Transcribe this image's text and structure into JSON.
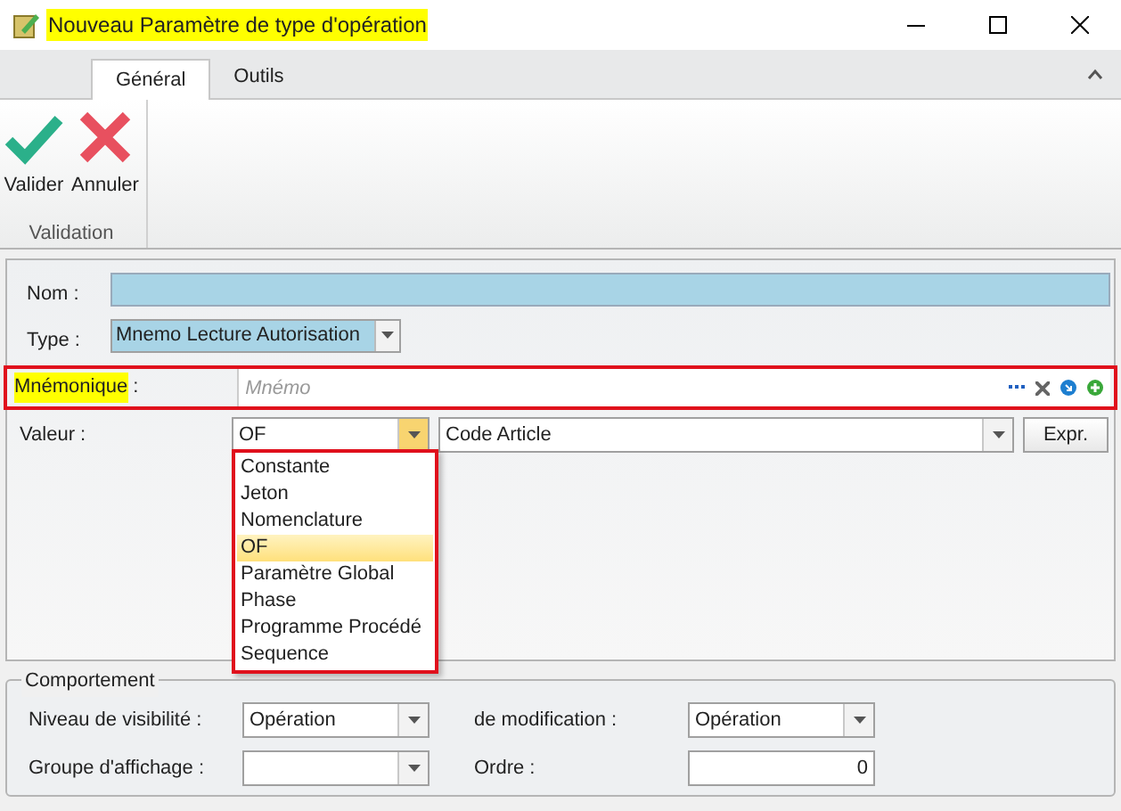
{
  "window": {
    "title": "Nouveau Paramètre de type d'opération",
    "title_highlighted": true
  },
  "ribbon": {
    "tabs": [
      {
        "label": "Général",
        "selected": true
      },
      {
        "label": "Outils",
        "selected": false
      }
    ],
    "groups": [
      {
        "label": "Validation",
        "buttons": [
          {
            "label": "Valider",
            "kind": "confirm"
          },
          {
            "label": "Annuler",
            "kind": "cancel"
          }
        ]
      }
    ]
  },
  "form": {
    "nom": {
      "label": "Nom :"
    },
    "type": {
      "label": "Type :",
      "value": "Mnemo Lecture Autorisation"
    },
    "mnemonique": {
      "label": "Mnémonique",
      "label_highlighted": true,
      "colon": ":",
      "placeholder": "Mnémo",
      "annotated": true
    },
    "valeur": {
      "label": "Valeur :",
      "source": "OF",
      "source_open": true,
      "field": "Code Article",
      "button": "Expr.",
      "options": [
        {
          "label": "Constante",
          "selected": false
        },
        {
          "label": "Jeton",
          "selected": false
        },
        {
          "label": "Nomenclature",
          "selected": false
        },
        {
          "label": "OF",
          "selected": true
        },
        {
          "label": "Paramètre Global",
          "selected": false
        },
        {
          "label": "Phase",
          "selected": false
        },
        {
          "label": "Programme Procédé",
          "selected": false
        },
        {
          "label": "Sequence",
          "selected": false
        }
      ],
      "options_annotated": true
    }
  },
  "comportement": {
    "title": "Comportement",
    "fields": [
      {
        "label": "Niveau de visibilité :",
        "value": "Opération",
        "kind": "combo"
      },
      {
        "label": "de modification :",
        "value": "Opération",
        "kind": "combo"
      },
      {
        "label": "Groupe d'affichage :",
        "kind": "combo"
      },
      {
        "label": "Ordre :",
        "value": "0",
        "kind": "number"
      }
    ]
  }
}
